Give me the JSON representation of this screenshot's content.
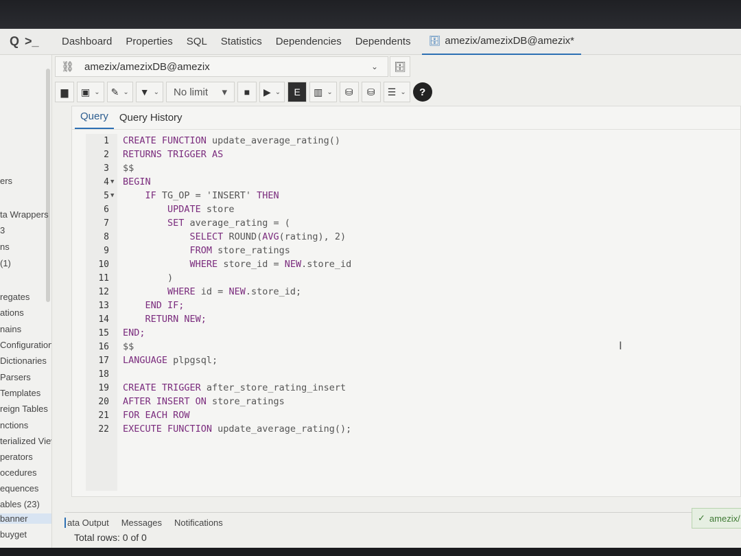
{
  "tabs": {
    "items": [
      {
        "label": "Dashboard"
      },
      {
        "label": "Properties"
      },
      {
        "label": "SQL"
      },
      {
        "label": "Statistics"
      },
      {
        "label": "Dependencies"
      },
      {
        "label": "Dependents"
      }
    ],
    "active_label": "amezix/amezixDB@amezix*"
  },
  "connection": {
    "value": "amezix/amezixDB@amezix"
  },
  "toolbar": {
    "limit_value": "No limit"
  },
  "query_tabs": {
    "query": "Query",
    "history": "Query History"
  },
  "sidebar": {
    "items": [
      "ers",
      "ta Wrappers",
      "3",
      "ns",
      "(1)",
      "regates",
      "ations",
      "nains",
      "Configuration:",
      "Dictionaries",
      "Parsers",
      "Templates",
      "reign Tables",
      "nctions",
      "terialized Views",
      "perators",
      "ocedures",
      "equences",
      "ables (23)",
      "banner",
      "buyget"
    ]
  },
  "editor": {
    "lines": [
      {
        "n": "1",
        "fold": "",
        "parts": [
          {
            "t": "CREATE FUNCTION ",
            "k": true
          },
          {
            "t": "update_average_rating()",
            "k": false
          }
        ]
      },
      {
        "n": "2",
        "fold": "",
        "parts": [
          {
            "t": "RETURNS TRIGGER AS",
            "k": true
          }
        ]
      },
      {
        "n": "3",
        "fold": "",
        "parts": [
          {
            "t": "$$",
            "k": false
          }
        ]
      },
      {
        "n": "4",
        "fold": "▼",
        "parts": [
          {
            "t": "BEGIN",
            "k": true
          }
        ]
      },
      {
        "n": "5",
        "fold": "▼",
        "parts": [
          {
            "t": "    IF ",
            "k": true
          },
          {
            "t": "TG_OP = 'INSERT' ",
            "k": false
          },
          {
            "t": "THEN",
            "k": true
          }
        ]
      },
      {
        "n": "6",
        "fold": "",
        "parts": [
          {
            "t": "        UPDATE ",
            "k": true
          },
          {
            "t": "store",
            "k": false
          }
        ]
      },
      {
        "n": "7",
        "fold": "",
        "parts": [
          {
            "t": "        SET ",
            "k": true
          },
          {
            "t": "average_rating = (",
            "k": false
          }
        ]
      },
      {
        "n": "8",
        "fold": "",
        "parts": [
          {
            "t": "            SELECT ",
            "k": true
          },
          {
            "t": "ROUND(",
            "k": false
          },
          {
            "t": "AVG",
            "k": true
          },
          {
            "t": "(rating), 2)",
            "k": false
          }
        ]
      },
      {
        "n": "9",
        "fold": "",
        "parts": [
          {
            "t": "            FROM ",
            "k": true
          },
          {
            "t": "store_ratings",
            "k": false
          }
        ]
      },
      {
        "n": "10",
        "fold": "",
        "parts": [
          {
            "t": "            WHERE ",
            "k": true
          },
          {
            "t": "store_id = ",
            "k": false
          },
          {
            "t": "NEW",
            "k": true
          },
          {
            "t": ".store_id",
            "k": false
          }
        ]
      },
      {
        "n": "11",
        "fold": "",
        "parts": [
          {
            "t": "        )",
            "k": false
          }
        ]
      },
      {
        "n": "12",
        "fold": "",
        "parts": [
          {
            "t": "        WHERE ",
            "k": true
          },
          {
            "t": "id = ",
            "k": false
          },
          {
            "t": "NEW",
            "k": true
          },
          {
            "t": ".store_id;",
            "k": false
          }
        ]
      },
      {
        "n": "13",
        "fold": "",
        "parts": [
          {
            "t": "    END IF;",
            "k": true
          }
        ]
      },
      {
        "n": "14",
        "fold": "",
        "parts": [
          {
            "t": "    RETURN NEW;",
            "k": true
          }
        ]
      },
      {
        "n": "15",
        "fold": "",
        "parts": [
          {
            "t": "END;",
            "k": true
          }
        ]
      },
      {
        "n": "16",
        "fold": "",
        "parts": [
          {
            "t": "$$",
            "k": false
          }
        ]
      },
      {
        "n": "17",
        "fold": "",
        "parts": [
          {
            "t": "LANGUAGE ",
            "k": true
          },
          {
            "t": "plpgsql;",
            "k": false
          }
        ]
      },
      {
        "n": "18",
        "fold": "",
        "parts": []
      },
      {
        "n": "19",
        "fold": "",
        "parts": [
          {
            "t": "CREATE TRIGGER ",
            "k": true
          },
          {
            "t": "after_store_rating_insert",
            "k": false
          }
        ]
      },
      {
        "n": "20",
        "fold": "",
        "parts": [
          {
            "t": "AFTER INSERT ON ",
            "k": true
          },
          {
            "t": "store_ratings",
            "k": false
          }
        ]
      },
      {
        "n": "21",
        "fold": "",
        "parts": [
          {
            "t": "FOR EACH ROW",
            "k": true
          }
        ]
      },
      {
        "n": "22",
        "fold": "",
        "parts": [
          {
            "t": "EXECUTE FUNCTION ",
            "k": true
          },
          {
            "t": "update_average_rating();",
            "k": false
          }
        ]
      }
    ]
  },
  "results": {
    "tabs": [
      "ata Output",
      "Messages",
      "Notifications"
    ],
    "total": "Total rows: 0 of 0"
  },
  "toast": {
    "text": "amezix/"
  }
}
